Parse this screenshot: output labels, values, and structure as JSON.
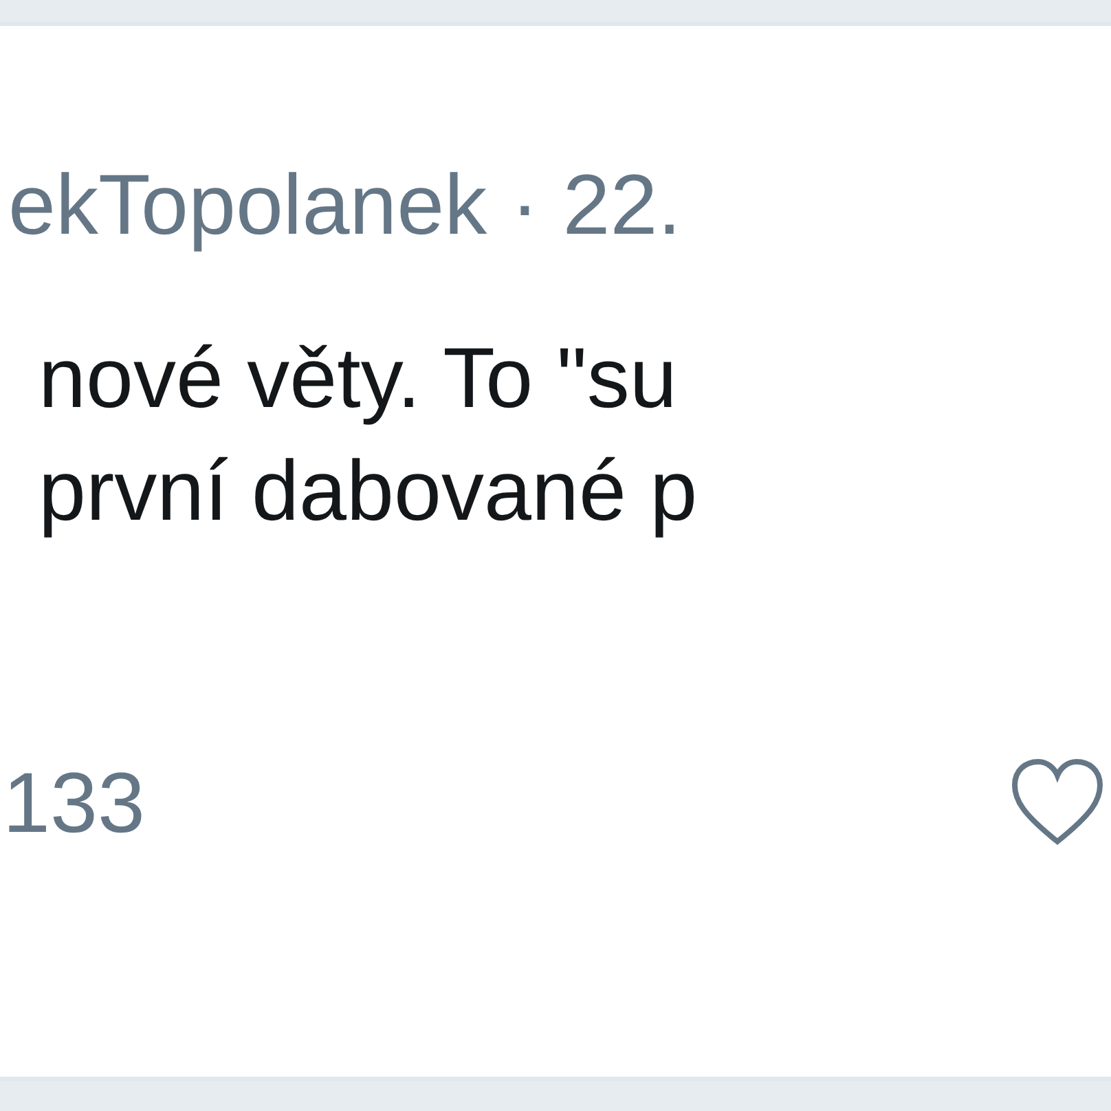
{
  "tweet": {
    "header": "ekTopolanek · 22.",
    "text_lines": [
      "nové věty. To \"su",
      "první dabované p"
    ],
    "reply_count": "133",
    "liked": false
  }
}
